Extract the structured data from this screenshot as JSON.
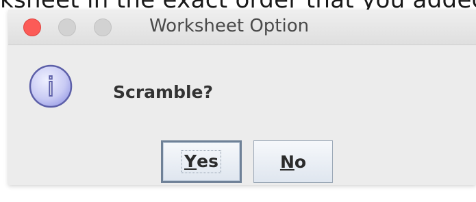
{
  "background": {
    "text": "ksheet in the exact order that you added th"
  },
  "dialog": {
    "title": "Worksheet Option",
    "message": "Scramble?",
    "icon": "info-icon",
    "icon_letter": "i",
    "buttons": {
      "yes": {
        "mnemonic": "Y",
        "rest": "es"
      },
      "no": {
        "mnemonic": "N",
        "rest": "o"
      }
    }
  },
  "colors": {
    "close": "#fc5b57",
    "inactive_traffic": "#d2d2d2",
    "dialog_bg": "#ececec",
    "icon_fill": "#c9cbf4",
    "icon_stroke": "#5c5fa8"
  }
}
